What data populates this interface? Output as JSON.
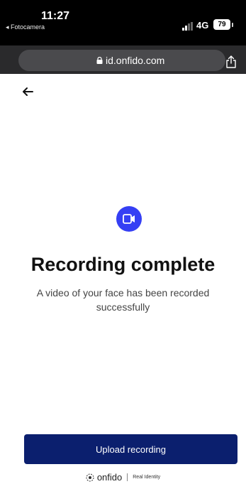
{
  "status_bar": {
    "time": "11:27",
    "back_app": "◂ Fotocamera",
    "network": "4G",
    "battery": "79"
  },
  "browser": {
    "url": "id.onfido.com"
  },
  "main": {
    "title": "Recording complete",
    "subtitle": "A video of your face has been recorded successfully",
    "upload_button": "Upload recording"
  },
  "footer": {
    "brand": "onfido",
    "tagline": "Real Identity"
  },
  "colors": {
    "accent": "#353ff4",
    "button": "#0b1f6e"
  },
  "icons": [
    "signal-icon",
    "lock-icon",
    "share-icon",
    "back-arrow-icon",
    "video-camera-icon",
    "onfido-logo-icon"
  ]
}
